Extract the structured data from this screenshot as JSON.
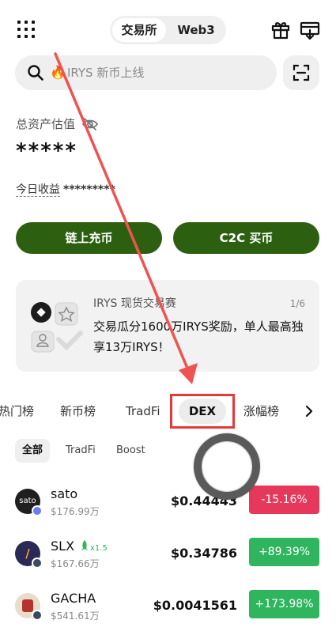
{
  "header": {
    "segments": [
      "交易所",
      "Web3"
    ],
    "active_segment": "交易所"
  },
  "search": {
    "fire_icon": "🔥",
    "placeholder": "IRYS 新币上线"
  },
  "assets": {
    "label": "总资产估值",
    "value": "*****",
    "today_label": "今日收益",
    "today_value": "*********"
  },
  "actions": {
    "deposit": "链上充币",
    "c2c": "C2C 买币"
  },
  "promo": {
    "title": "IRYS 现货交易赛",
    "pager": "1/6",
    "desc": "交易瓜分1600万IRYS奖励，单人最高独享13万IRYS！"
  },
  "tabs": [
    "热门榜",
    "新币榜",
    "TradFi",
    "DEX",
    "涨幅榜"
  ],
  "active_tab": "DEX",
  "chips": [
    "全部",
    "TradFi",
    "Boost"
  ],
  "rows": [
    {
      "symbol": "sato",
      "volume": "$176.99万",
      "price": "$0.44443",
      "change": "-15.16%",
      "direction": "down",
      "badge": ""
    },
    {
      "symbol": "SLX",
      "volume": "$167.66万",
      "price": "$0.34786",
      "change": "+89.39%",
      "direction": "up",
      "badge": "x1.5"
    },
    {
      "symbol": "GACHA",
      "volume": "$541.61万",
      "price": "$0.0041561",
      "change": "+173.98%",
      "direction": "up",
      "badge": ""
    }
  ],
  "colors": {
    "primary_green": "#2c5f10",
    "up": "#2fb55d",
    "down": "#e5385a",
    "annotation_red": "#e5383b"
  },
  "icons": {
    "menu": "grid-icon",
    "gift": "gift-icon",
    "download": "download-icon",
    "search": "search-icon",
    "scan": "scan-icon",
    "eye_hidden": "eye-off-icon",
    "chevron": "chevron-right-icon"
  }
}
